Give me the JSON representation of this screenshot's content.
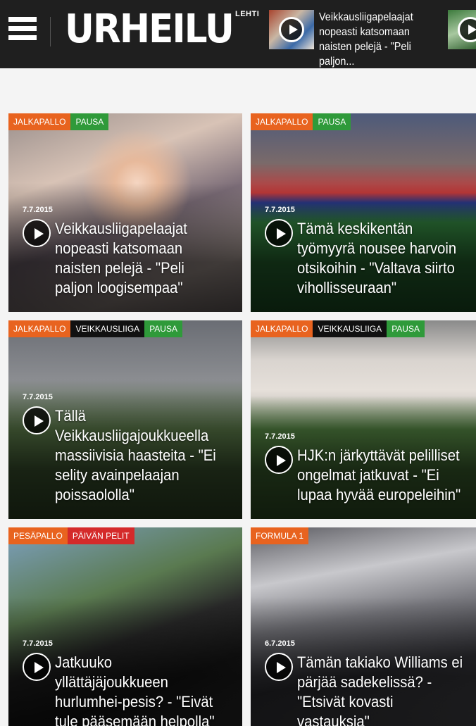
{
  "header": {
    "logo": "URHEILU",
    "logo_sub": "LEHTI",
    "promo_title": "Veikkausliigapelaajat nopeasti katsomaan naisten pelejä - \"Peli paljon..."
  },
  "colors": {
    "tag_orange": "#e8631f",
    "tag_green": "#2f9a3a",
    "tag_black": "#111111",
    "tag_red": "#d42a2a"
  },
  "articles": [
    {
      "tags": [
        "JALKAPALLO",
        "PAUSA"
      ],
      "date": "7.7.2015",
      "title": "Veikkausliigapelaajat nopeasti katsomaan naisten pelejä - \"Peli paljon loogisempaa\""
    },
    {
      "tags": [
        "JALKAPALLO",
        "PAUSA"
      ],
      "date": "7.7.2015",
      "title": "Tämä keskikentän työmyyrä nousee harvoin otsikoihin - \"Valtava siirto vihollisseuraan\""
    },
    {
      "tags": [
        "JALKAPALLO",
        "VEIKKAUSLIIGA",
        "PAUSA"
      ],
      "date": "7.7.2015",
      "title": "Tällä Veikkausliigajoukkueella massiivisia haasteita - \"Ei selity avainpelaajan poissaololla\""
    },
    {
      "tags": [
        "JALKAPALLO",
        "VEIKKAUSLIIGA",
        "PAUSA"
      ],
      "date": "7.7.2015",
      "title": "HJK:n järkyttävät pelilliset ongelmat jatkuvat - \"Ei lupaa hyvää europeleihin\""
    },
    {
      "tags": [
        "PESÄPALLO",
        "PÄIVÄN PELIT"
      ],
      "date": "7.7.2015",
      "title": "Jatkuuko yllättäjäjoukkueen hurlumhei-pesis? - \"Eivät tule pääsemään helpolla\""
    },
    {
      "tags": [
        "FORMULA 1"
      ],
      "date": "6.7.2015",
      "title": "Tämän takiako Williams ei pärjää sadekelissä? - \"Etsivät kovasti vastauksia\""
    }
  ]
}
